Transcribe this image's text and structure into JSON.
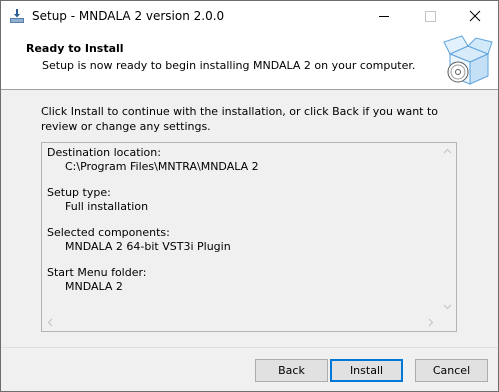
{
  "window": {
    "title": "Setup - MNDALA 2 version 2.0.0"
  },
  "header": {
    "title": "Ready to Install",
    "subtitle": "Setup is now ready to begin installing MNDALA 2 on your computer."
  },
  "intro": "Click Install to continue with the installation, or click Back if you want to review or change any settings.",
  "summary": {
    "destination_label": "Destination location:",
    "destination_value": "C:\\Program Files\\MNTRA\\MNDALA 2",
    "setup_type_label": "Setup type:",
    "setup_type_value": "Full installation",
    "components_label": "Selected components:",
    "components_value": "MNDALA 2 64-bit VST3i Plugin",
    "startmenu_label": "Start Menu folder:",
    "startmenu_value": "MNDALA 2"
  },
  "buttons": {
    "back": "Back",
    "install": "Install",
    "cancel": "Cancel"
  },
  "colors": {
    "accent": "#0078d7",
    "panel": "#f0f0f0"
  }
}
